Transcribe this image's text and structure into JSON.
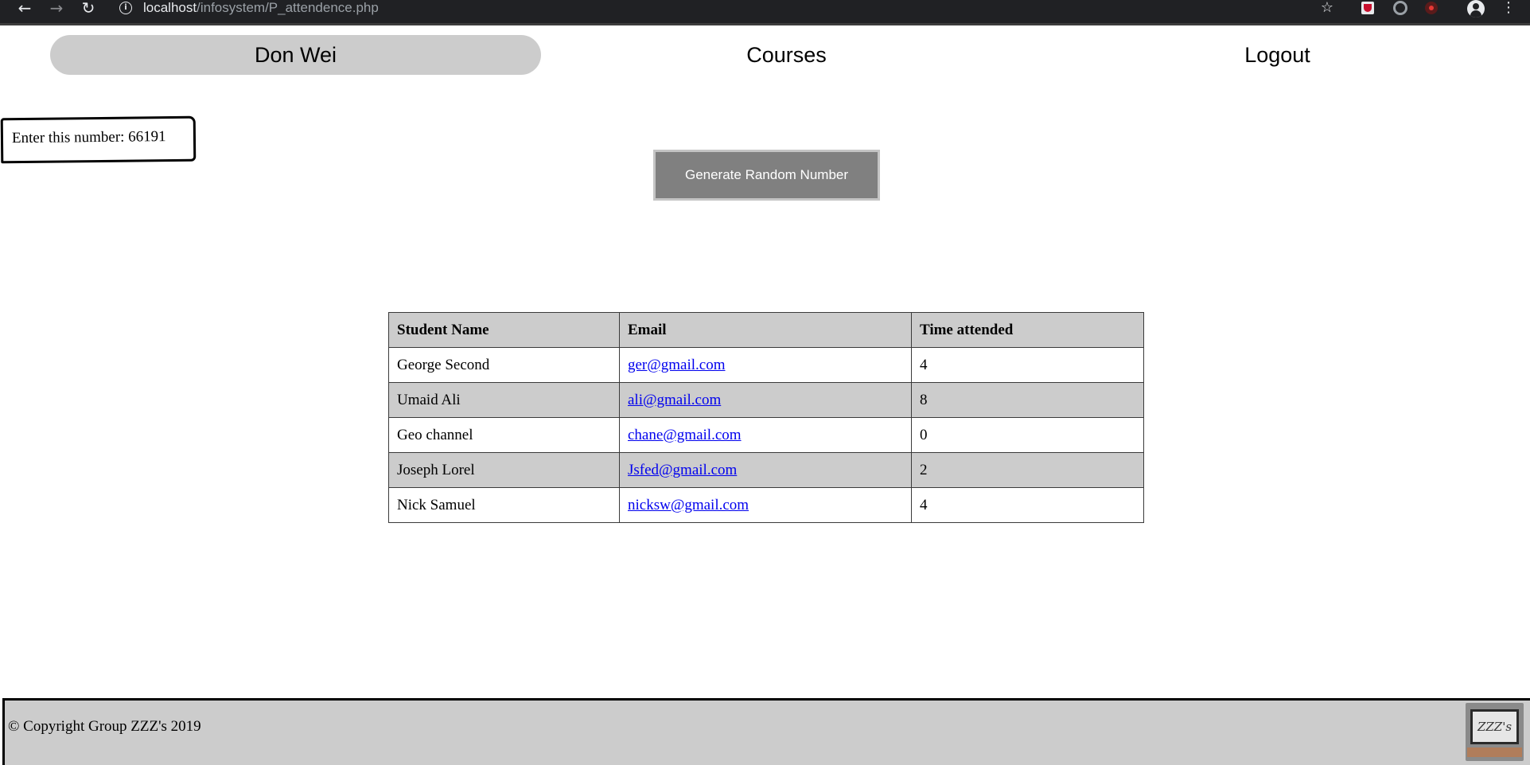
{
  "browser": {
    "url_host": "localhost",
    "url_path": "/infosystem/P_attendence.php"
  },
  "nav": {
    "user": "Don Wei",
    "courses": "Courses",
    "logout": "Logout"
  },
  "prompt": {
    "label": "Enter this number: 66191"
  },
  "generate_button": "Generate Random Number",
  "table": {
    "headers": [
      "Student Name",
      "Email",
      "Time attended"
    ],
    "rows": [
      {
        "name": "George Second",
        "email": "ger@gmail.com",
        "attended": "4"
      },
      {
        "name": "Umaid Ali",
        "email": "ali@gmail.com",
        "attended": "8"
      },
      {
        "name": "Geo channel",
        "email": "chane@gmail.com",
        "attended": "0"
      },
      {
        "name": "Joseph Lorel",
        "email": "Jsfed@gmail.com",
        "attended": "2"
      },
      {
        "name": "Nick Samuel",
        "email": "nicksw@gmail.com",
        "attended": "4"
      }
    ]
  },
  "footer": {
    "copyright": "© Copyright Group ZZZ's 2019",
    "logo_text": "ZZZ's"
  },
  "colors": {
    "nav_active_bg": "#cccccc",
    "button_bg": "#808080",
    "row_alt_bg": "#cccccc",
    "footer_bg": "#cccccc",
    "link": "#0000ee"
  },
  "icons": [
    "back-icon",
    "forward-icon",
    "reload-icon",
    "info-icon",
    "star-icon",
    "extension-shield-icon",
    "extension-circle-icon",
    "extension-red-icon",
    "profile-icon",
    "menu-dots-icon"
  ]
}
